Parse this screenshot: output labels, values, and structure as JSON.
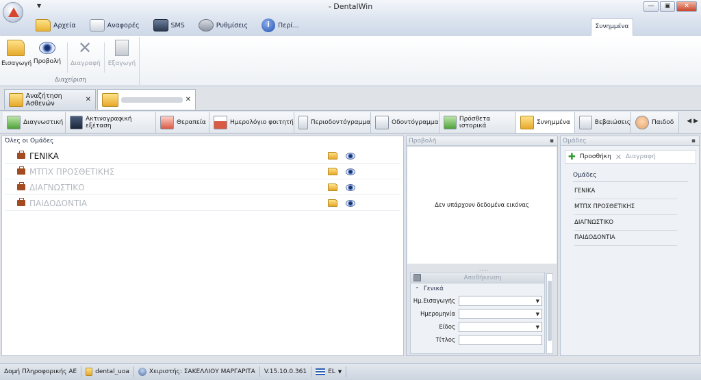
{
  "window": {
    "title": "- DentalWin",
    "quick_access": "▼",
    "minimize": "—",
    "maximize": "▣",
    "close": "✕"
  },
  "menu": [
    {
      "label": "Αρχεία",
      "icon": "folder-icon"
    },
    {
      "label": "Αναφορές",
      "icon": "report-icon"
    },
    {
      "label": "SMS",
      "icon": "sms-icon"
    },
    {
      "label": "Ρυθμίσεις",
      "icon": "tools-icon"
    },
    {
      "label": "Περί...",
      "icon": "info-icon"
    }
  ],
  "context_tab": "Συνημμένα",
  "ribbon": {
    "group_label": "Διαχείριση",
    "buttons": [
      {
        "label": "Εισαγωγή",
        "enabled": true
      },
      {
        "label": "Προβολή",
        "enabled": true
      },
      {
        "label": "Διαγραφή",
        "enabled": false
      },
      {
        "label": "Εξαγωγή",
        "enabled": false
      }
    ]
  },
  "doc_tabs": [
    {
      "label": "Αναζήτηση Ασθενών",
      "close": "✕"
    },
    {
      "label": "",
      "close": "✕"
    }
  ],
  "section_tabs": [
    {
      "label": "Διαγνωστική",
      "icon": "diagnostic-icon"
    },
    {
      "label": "Ακτινογραφική εξέταση",
      "icon": "xray-icon"
    },
    {
      "label": "Θεραπεία",
      "icon": "treatment-icon"
    },
    {
      "label": "Ημερολόγιο φοιτητή",
      "icon": "calendar-icon"
    },
    {
      "label": "Περιοδοντόγραμμα",
      "icon": "periodontogram-icon"
    },
    {
      "label": "Οδοντόγραμμα",
      "icon": "odontogram-icon"
    },
    {
      "label": "Πρόσθετα ιστορικά",
      "icon": "history-icon"
    },
    {
      "label": "Συνημμένα",
      "icon": "attachments-icon"
    },
    {
      "label": "Βεβαιώσεις",
      "icon": "certificates-icon"
    },
    {
      "label": "Παιδοδ",
      "icon": "pediatric-icon"
    }
  ],
  "tab_scroll": "◀ ▶",
  "groups_pane": {
    "title": "Όλες οι Ομάδες",
    "rows": [
      "ΓΕΝΙΚΑ",
      "ΜΤΠΧ ΠΡΟΣΘΕΤΙΚΗΣ",
      "ΔΙΑΓΝΩΣΤΙΚΟ",
      "ΠΑΙΔΟΔΟΝΤΙΑ"
    ]
  },
  "preview_pane": {
    "title": "Προβολή",
    "pin": "▪",
    "no_image": "Δεν υπάρχουν δεδομένα εικόνας",
    "splitter": "......",
    "save": "Αποθήκευση",
    "section": "Γενικά",
    "fields": [
      {
        "label": "Ημ.Εισαγωγής",
        "value": "",
        "dropdown": true
      },
      {
        "label": "Ημερομηνία",
        "value": "",
        "dropdown": true
      },
      {
        "label": "Είδος",
        "value": "",
        "dropdown": true
      },
      {
        "label": "Τίτλος",
        "value": "",
        "dropdown": false
      }
    ],
    "dd_arrow": "▼"
  },
  "groups_side": {
    "title": "Ομάδες",
    "pin": "▪",
    "add": "Προσθήκη",
    "delete": "Διαγραφή",
    "section": "Ομάδες",
    "items": [
      "ΓΕΝΙΚΑ",
      "ΜΤΠΧ ΠΡΟΣΘΕΤΙΚΗΣ",
      "ΔΙΑΓΝΩΣΤΙΚΟ",
      "ΠΑΙΔΟΔΟΝΤΙΑ"
    ]
  },
  "status": {
    "company": "Δομή Πληροφορικής ΑΕ",
    "database": "dental_uoa",
    "user": "Χειριστής: ΣΑΚΕΛΛΙΟΥ ΜΑΡΓΑΡΙΤΑ",
    "version": "V.15.10.0.361",
    "language": "EL"
  }
}
